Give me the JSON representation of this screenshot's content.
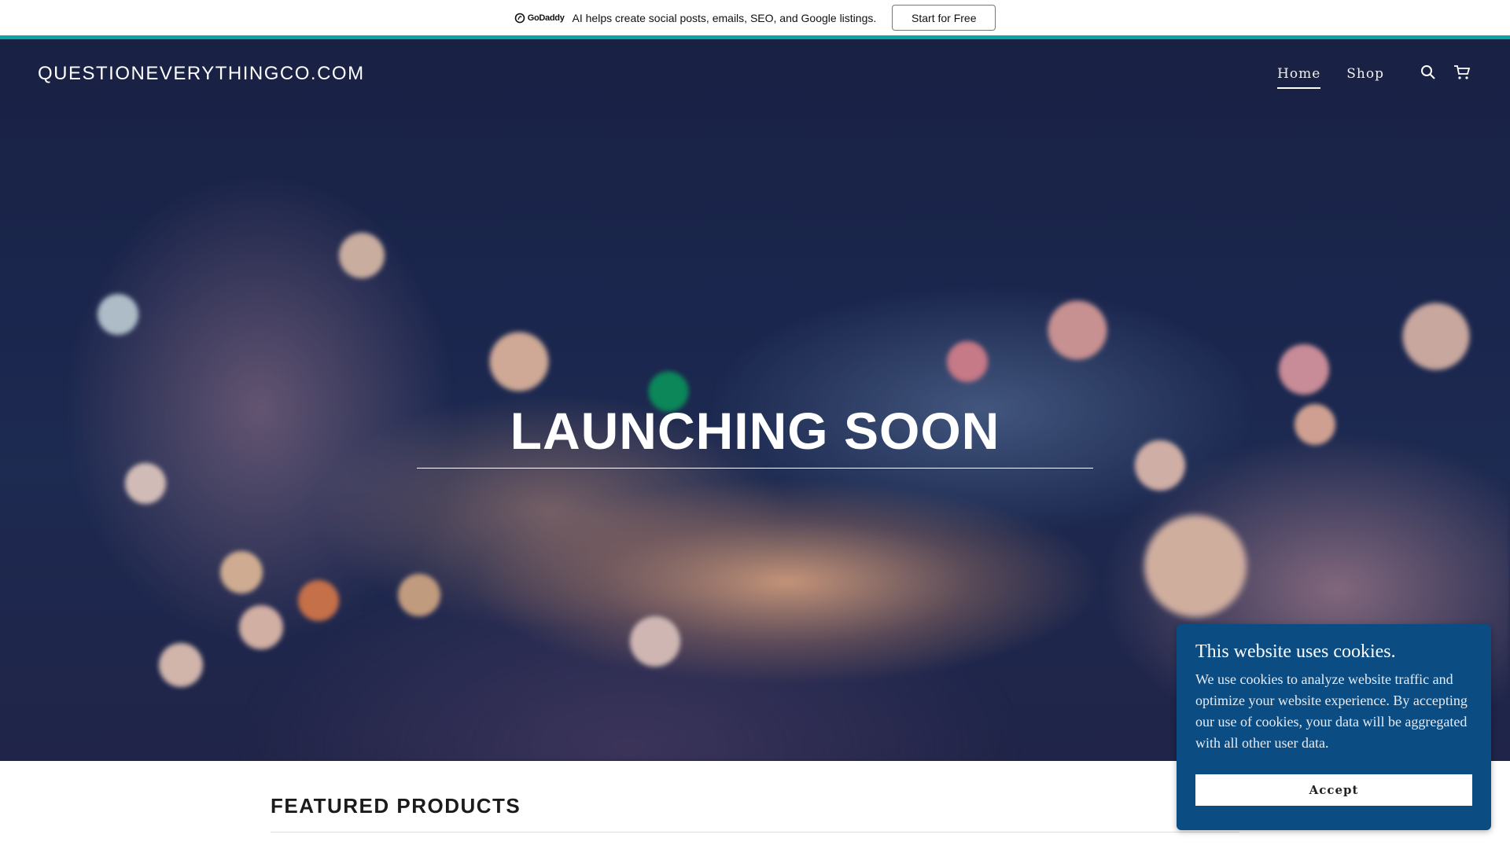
{
  "promo": {
    "brand": "GoDaddy",
    "message": "AI helps create social posts, emails, SEO, and Google listings.",
    "cta": "Start for Free"
  },
  "header": {
    "site_title": "QUESTIONEVERYTHINGCO.COM",
    "nav": [
      {
        "label": "Home",
        "active": true
      },
      {
        "label": "Shop",
        "active": false
      }
    ],
    "icons": [
      "search-icon",
      "cart-icon"
    ]
  },
  "hero": {
    "headline": "LAUNCHING SOON"
  },
  "featured": {
    "heading": "FEATURED PRODUCTS"
  },
  "cookie": {
    "title": "This website uses cookies.",
    "body": "We use cookies to analyze website traffic and optimize your website experience. By accepting our use of cookies, your data will be aggregated with all other user data.",
    "accept": "Accept"
  },
  "colors": {
    "teal": "#09a5a5",
    "cookie_bg": "#0b4c83",
    "hero_bg": "#1c2850"
  }
}
